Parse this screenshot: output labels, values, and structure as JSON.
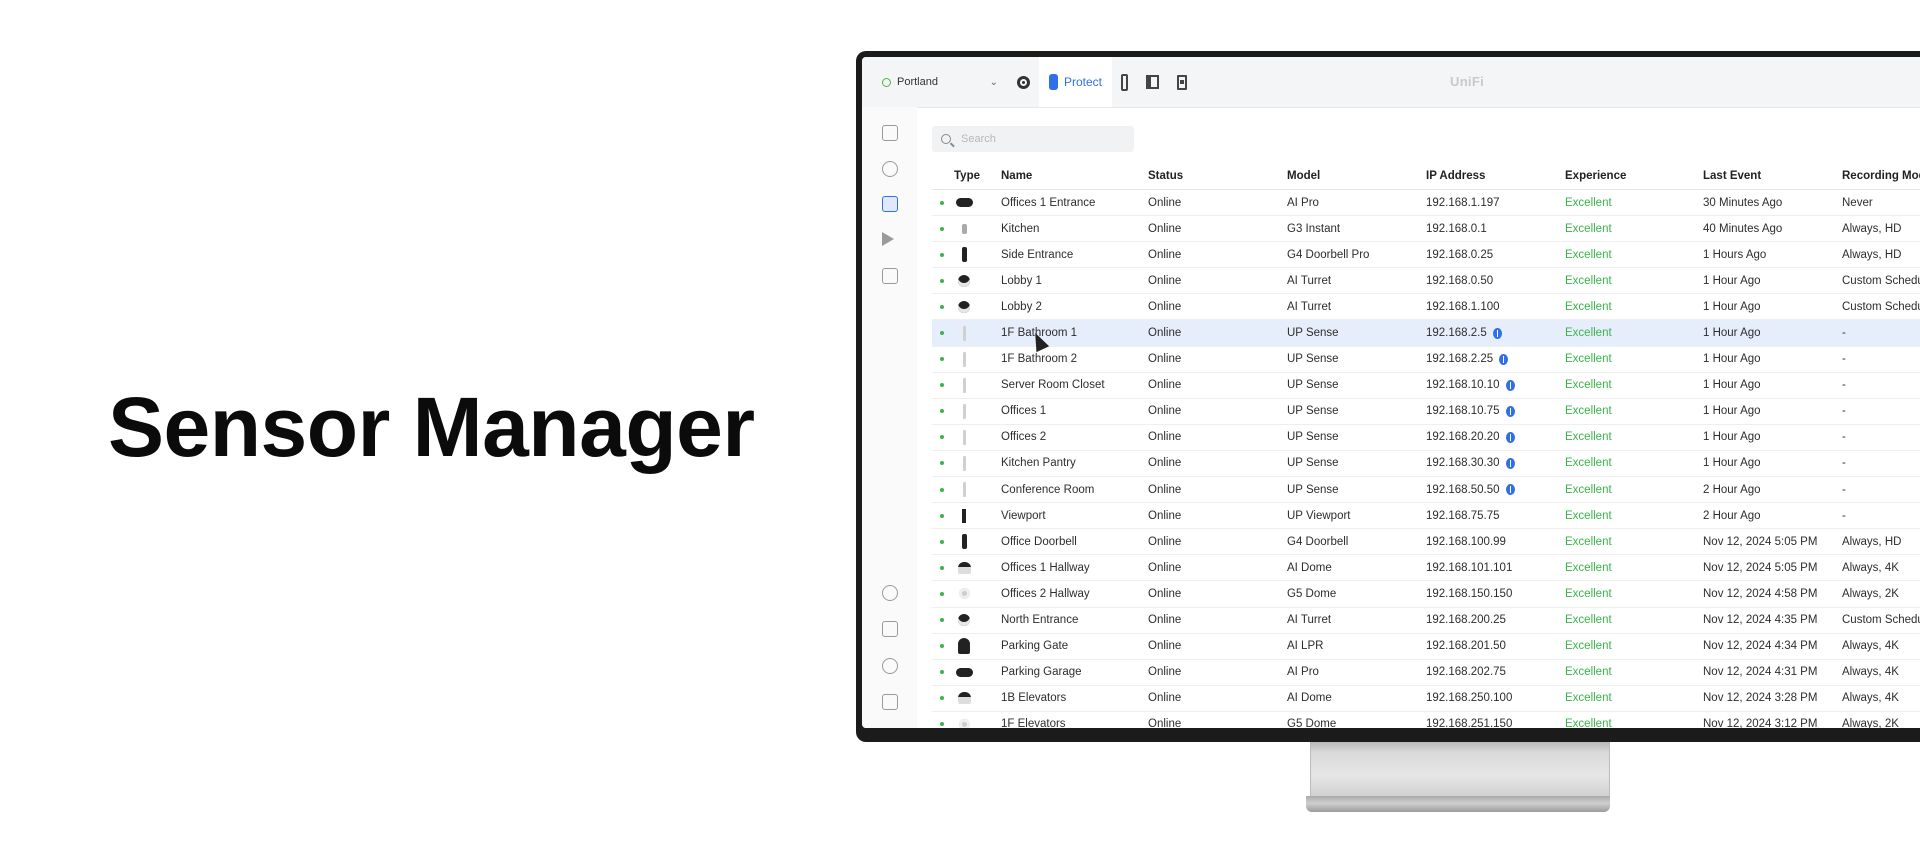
{
  "hero": {
    "title": "Sensor Manager"
  },
  "app": {
    "site": "Portland",
    "active_tab": "Protect",
    "brand": "UniFi",
    "search_placeholder": "Search"
  },
  "table": {
    "columns": {
      "type": "Type",
      "name": "Name",
      "status": "Status",
      "model": "Model",
      "ip": "IP Address",
      "experience": "Experience",
      "last_event": "Last  Event",
      "recording": "Recording Mode"
    },
    "rows": [
      {
        "device": "bullet",
        "name": "Offices 1 Entrance",
        "status": "Online",
        "model": "AI Pro",
        "ip": "192.168.1.197",
        "bt": false,
        "experience": "Excellent",
        "last_event": "30 Minutes Ago",
        "recording": "Never"
      },
      {
        "device": "mini",
        "name": "Kitchen",
        "status": "Online",
        "model": "G3 Instant",
        "ip": "192.168.0.1",
        "bt": false,
        "experience": "Excellent",
        "last_event": "40 Minutes Ago",
        "recording": "Always, HD"
      },
      {
        "device": "doorbell",
        "name": "Side Entrance",
        "status": "Online",
        "model": "G4 Doorbell Pro",
        "ip": "192.168.0.25",
        "bt": false,
        "experience": "Excellent",
        "last_event": "1 Hours Ago",
        "recording": "Always, HD"
      },
      {
        "device": "turret",
        "name": "Lobby 1",
        "status": "Online",
        "model": "AI Turret",
        "ip": "192.168.0.50",
        "bt": false,
        "experience": "Excellent",
        "last_event": "1 Hour Ago",
        "recording": "Custom Schedule"
      },
      {
        "device": "turret",
        "name": "Lobby 2",
        "status": "Online",
        "model": "AI Turret",
        "ip": "192.168.1.100",
        "bt": false,
        "experience": "Excellent",
        "last_event": "1 Hour Ago",
        "recording": "Custom Schedule"
      },
      {
        "device": "sense",
        "name": "1F Bathroom 1",
        "status": "Online",
        "model": "UP Sense",
        "ip": "192.168.2.5",
        "bt": true,
        "experience": "Excellent",
        "last_event": "1 Hour Ago",
        "recording": "-",
        "selected": true
      },
      {
        "device": "sense",
        "name": "1F Bathroom 2",
        "status": "Online",
        "model": "UP Sense",
        "ip": "192.168.2.25",
        "bt": true,
        "experience": "Excellent",
        "last_event": "1 Hour Ago",
        "recording": "-"
      },
      {
        "device": "sense",
        "name": "Server Room Closet",
        "status": "Online",
        "model": "UP Sense",
        "ip": "192.168.10.10",
        "bt": true,
        "experience": "Excellent",
        "last_event": "1 Hour Ago",
        "recording": "-"
      },
      {
        "device": "sense",
        "name": "Offices 1",
        "status": "Online",
        "model": "UP Sense",
        "ip": "192.168.10.75",
        "bt": true,
        "experience": "Excellent",
        "last_event": "1 Hour Ago",
        "recording": "-"
      },
      {
        "device": "sense",
        "name": "Offices 2",
        "status": "Online",
        "model": "UP Sense",
        "ip": "192.168.20.20",
        "bt": true,
        "experience": "Excellent",
        "last_event": "1 Hour Ago",
        "recording": "-"
      },
      {
        "device": "sense",
        "name": "Kitchen Pantry",
        "status": "Online",
        "model": "UP Sense",
        "ip": "192.168.30.30",
        "bt": true,
        "experience": "Excellent",
        "last_event": "1 Hour Ago",
        "recording": "-"
      },
      {
        "device": "sense",
        "name": "Conference Room",
        "status": "Online",
        "model": "UP Sense",
        "ip": "192.168.50.50",
        "bt": true,
        "experience": "Excellent",
        "last_event": "2 Hour Ago",
        "recording": "-"
      },
      {
        "device": "viewport",
        "name": "Viewport",
        "status": "Online",
        "model": "UP Viewport",
        "ip": "192.168.75.75",
        "bt": false,
        "experience": "Excellent",
        "last_event": "2 Hour Ago",
        "recording": "-"
      },
      {
        "device": "doorbell",
        "name": "Office Doorbell",
        "status": "Online",
        "model": "G4 Doorbell",
        "ip": "192.168.100.99",
        "bt": false,
        "experience": "Excellent",
        "last_event": "Nov 12, 2024 5:05 PM",
        "recording": "Always, HD"
      },
      {
        "device": "dome",
        "name": "Offices 1 Hallway",
        "status": "Online",
        "model": "AI Dome",
        "ip": "192.168.101.101",
        "bt": false,
        "experience": "Excellent",
        "last_event": "Nov 12, 2024 5:05 PM",
        "recording": "Always, 4K"
      },
      {
        "device": "dome-light",
        "name": "Offices 2 Hallway",
        "status": "Online",
        "model": "G5 Dome",
        "ip": "192.168.150.150",
        "bt": false,
        "experience": "Excellent",
        "last_event": "Nov 12, 2024 4:58 PM",
        "recording": "Always, 2K"
      },
      {
        "device": "turret",
        "name": "North Entrance",
        "status": "Online",
        "model": "AI Turret",
        "ip": "192.168.200.25",
        "bt": false,
        "experience": "Excellent",
        "last_event": "Nov 12, 2024 4:35 PM",
        "recording": "Custom Schedule"
      },
      {
        "device": "lpr",
        "name": "Parking Gate",
        "status": "Online",
        "model": "AI LPR",
        "ip": "192.168.201.50",
        "bt": false,
        "experience": "Excellent",
        "last_event": "Nov 12, 2024 4:34 PM",
        "recording": "Always, 4K"
      },
      {
        "device": "bullet",
        "name": "Parking Garage",
        "status": "Online",
        "model": "AI Pro",
        "ip": "192.168.202.75",
        "bt": false,
        "experience": "Excellent",
        "last_event": "Nov 12, 2024 4:31 PM",
        "recording": "Always, 4K"
      },
      {
        "device": "dome",
        "name": "1B Elevators",
        "status": "Online",
        "model": "AI Dome",
        "ip": "192.168.250.100",
        "bt": false,
        "experience": "Excellent",
        "last_event": "Nov 12, 2024 3:28 PM",
        "recording": "Always, 4K"
      },
      {
        "device": "dome-light",
        "name": "1F Elevators",
        "status": "Online",
        "model": "G5 Dome",
        "ip": "192.168.251.150",
        "bt": false,
        "experience": "Excellent",
        "last_event": "Nov 12, 2024 3:12 PM",
        "recording": "Always, 2K"
      }
    ]
  },
  "colors": {
    "accent": "#2f6fe8",
    "online": "#3ab44a"
  }
}
